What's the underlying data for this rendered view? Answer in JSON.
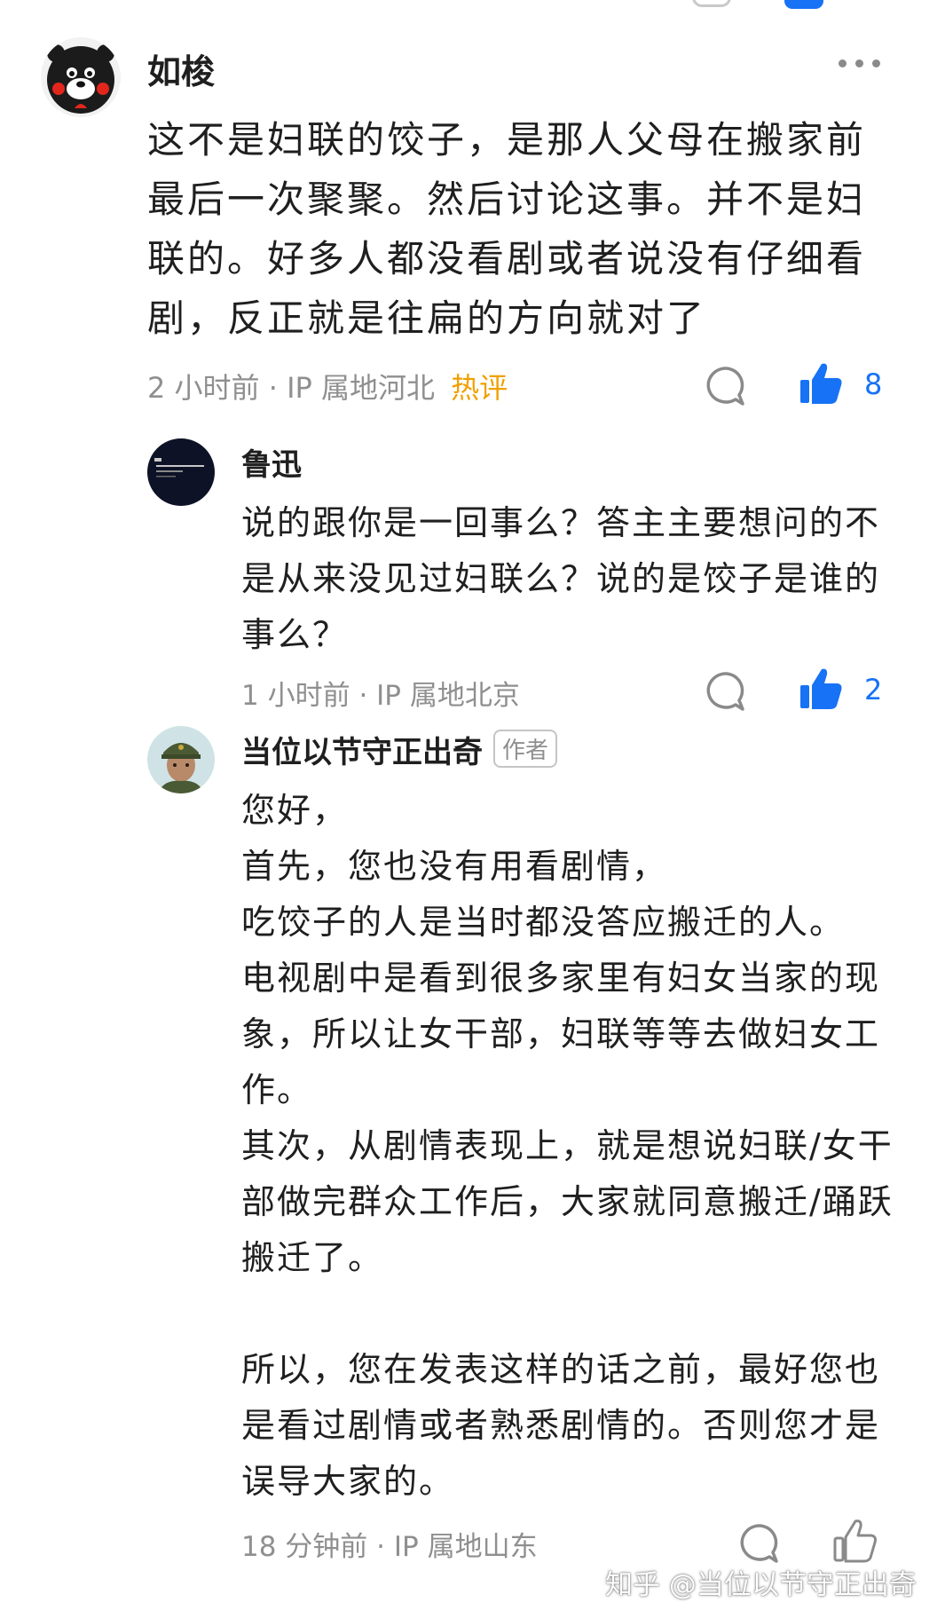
{
  "comments": [
    {
      "username": "如梭",
      "body": "这不是妇联的饺子，是那人父母在搬家前最后一次聚聚。然后讨论这事。并不是妇联的。好多人都没看剧或者说没有仔细看剧，反正就是往扁的方向就对了",
      "time": "2 小时前",
      "ip": "IP 属地河北",
      "hot_label": "热评",
      "like_count": "8",
      "avatar_icon": "kumamon-avatar-icon"
    },
    {
      "username": "鲁迅",
      "body": "说的跟你是一回事么？答主主要想问的不是从来没见过妇联么？说的是饺子是谁的事么？",
      "time": "1 小时前",
      "ip": "IP 属地北京",
      "like_count": "2",
      "avatar_icon": "dark-text-avatar-icon"
    },
    {
      "username": "当位以节守正出奇",
      "author_badge": "作者",
      "body": "您好，\n首先，您也没有用看剧情，\n吃饺子的人是当时都没答应搬迁的人。\n电视剧中是看到很多家里有妇女当家的现象，所以让女干部，妇联等等去做妇女工作。\n其次，从剧情表现上，就是想说妇联/女干部做完群众工作后，大家就同意搬迁/踊跃搬迁了。\n\n所以，您在发表这样的话之前，最好您也是看过剧情或者熟悉剧情的。否则您才是误导大家的。",
      "time": "18 分钟前",
      "ip": "IP 属地山东",
      "avatar_icon": "soldier-avatar-icon"
    }
  ],
  "meta_separator": "·",
  "watermark": "知乎 @当位以节守正出奇",
  "colors": {
    "accent": "#1772f6",
    "hot": "#f0a000",
    "meta": "#8f8f8f",
    "text": "#1f1f1f"
  }
}
